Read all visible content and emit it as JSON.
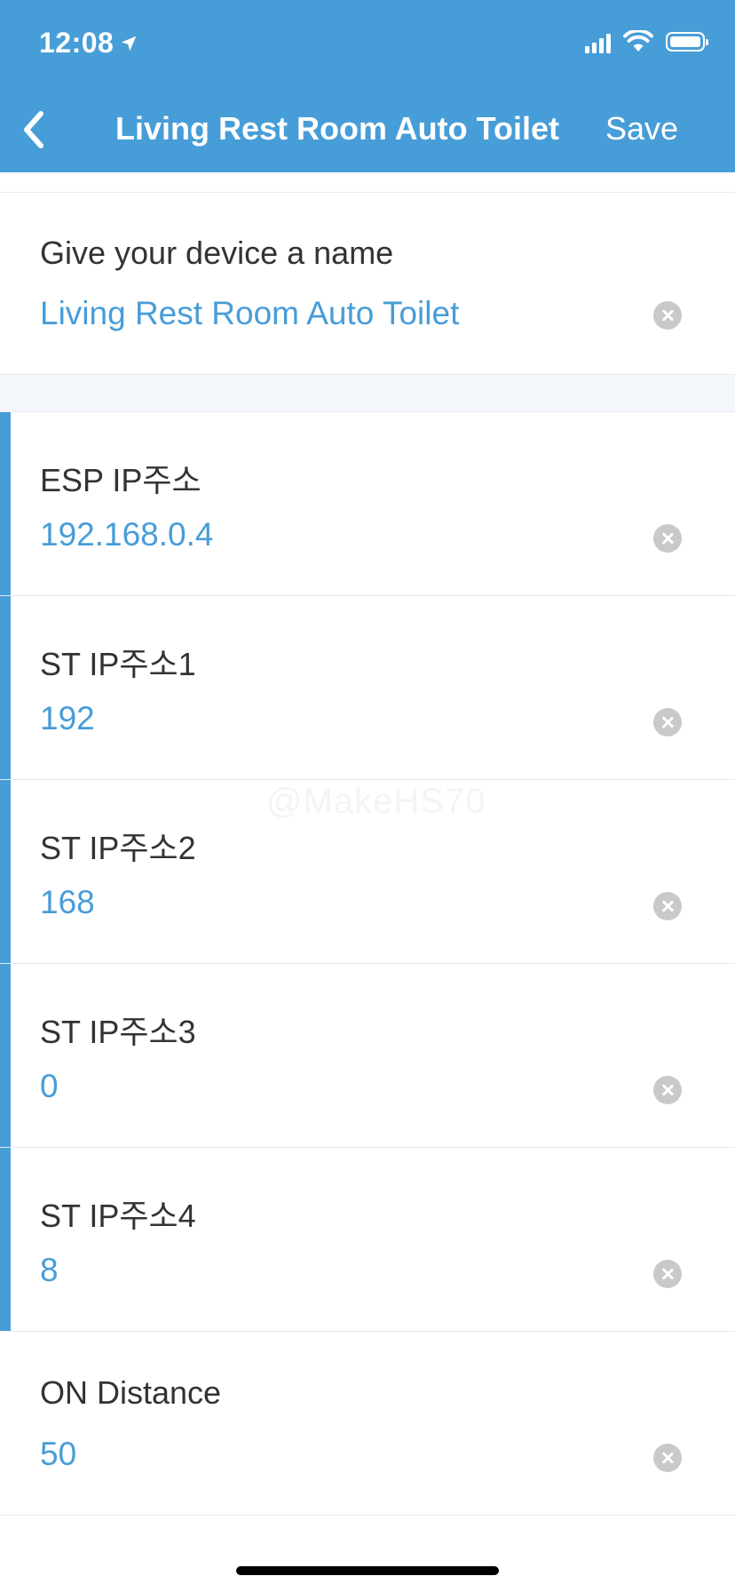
{
  "status_bar": {
    "time": "12:08"
  },
  "nav": {
    "title": "Living Rest Room Auto Toilet",
    "save_label": "Save"
  },
  "name_field": {
    "label": "Give your device a name",
    "value": "Living Rest Room Auto Toilet"
  },
  "fields": [
    {
      "label": "ESP IP주소",
      "value": "192.168.0.4"
    },
    {
      "label": "ST IP주소1",
      "value": "192"
    },
    {
      "label": "ST IP주소2",
      "value": "168"
    },
    {
      "label": "ST IP주소3",
      "value": "0"
    },
    {
      "label": "ST IP주소4",
      "value": "8"
    },
    {
      "label": "ON Distance",
      "value": "50"
    }
  ],
  "watermark": "@MakeHS70",
  "colors": {
    "accent": "#479dd7",
    "clear": "#c9c9c9",
    "text": "#333333"
  },
  "icons": [
    "location-arrow-icon",
    "cellular-signal-icon",
    "wifi-icon",
    "battery-icon",
    "back-chevron-icon",
    "clear-icon"
  ]
}
